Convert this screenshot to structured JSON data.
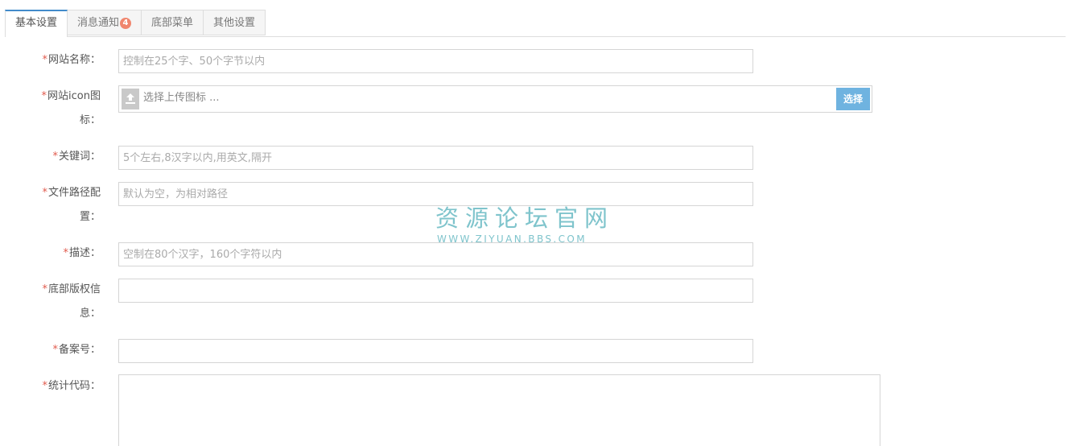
{
  "tabs": [
    {
      "label": "基本设置",
      "active": true
    },
    {
      "label": "消息通知",
      "badge": "4"
    },
    {
      "label": "底部菜单"
    },
    {
      "label": "其他设置"
    }
  ],
  "required_mark": "*",
  "form": {
    "site_name": {
      "label_l1": "网站名称：",
      "placeholder": "控制在25个字、50个字节以内",
      "value": ""
    },
    "site_icon": {
      "label_l1": "网站icon图",
      "label_l2": "标：",
      "placeholder": "选择上传图标 ...",
      "button": "选择"
    },
    "keywords": {
      "label_l1": "关键词：",
      "placeholder": "5个左右,8汉字以内,用英文,隔开",
      "value": ""
    },
    "file_path": {
      "label_l1": "文件路径配",
      "label_l2": "置：",
      "placeholder": "默认为空，为相对路径",
      "value": ""
    },
    "description": {
      "label_l1": "描述：",
      "placeholder": "空制在80个汉字，160个字符以内",
      "value": ""
    },
    "copyright": {
      "label_l1": "底部版权信",
      "label_l2": "息：",
      "value": ""
    },
    "icp": {
      "label_l1": "备案号：",
      "value": ""
    },
    "stats_code": {
      "label_l1": "统计代码：",
      "value": ""
    }
  },
  "watermark": {
    "title": "资源论坛官网",
    "url": "WWW.ZIYUAN.BBS.COM",
    "color": "#7fc4cc"
  },
  "colors": {
    "required": "#e15b4d",
    "tab_active_border": "#428bca",
    "badge": "#f0866e",
    "select_button": "#6fb3e0"
  }
}
